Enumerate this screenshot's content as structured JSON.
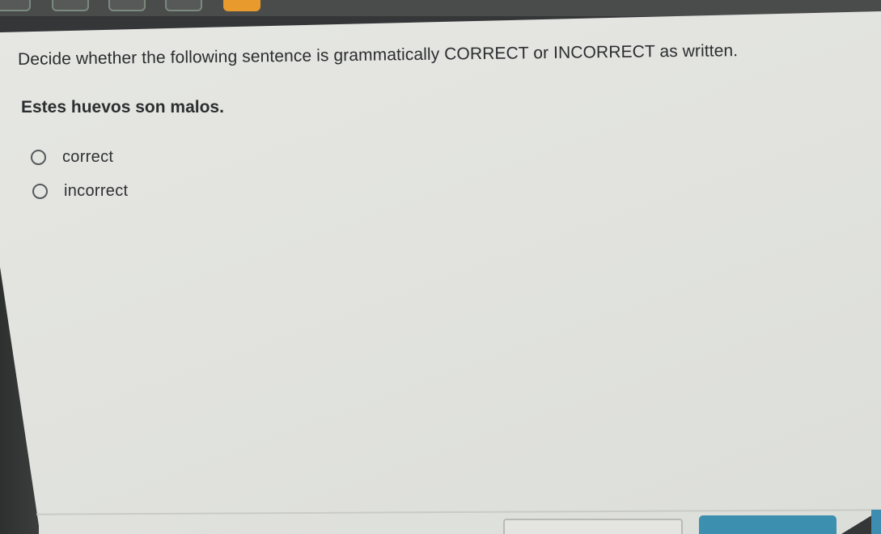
{
  "question": {
    "instruction": "Decide whether the following sentence is grammatically CORRECT or INCORRECT as written.",
    "sentence": "Estes huevos son malos.",
    "options": [
      {
        "label": "correct",
        "selected": false
      },
      {
        "label": "incorrect",
        "selected": false
      }
    ]
  },
  "navigation": {
    "question_tabs": 5,
    "active_tab": 5
  },
  "colors": {
    "active_tab": "#e89a2c",
    "next_button": "#3d8fb0",
    "card_background": "#e3e4e0"
  }
}
